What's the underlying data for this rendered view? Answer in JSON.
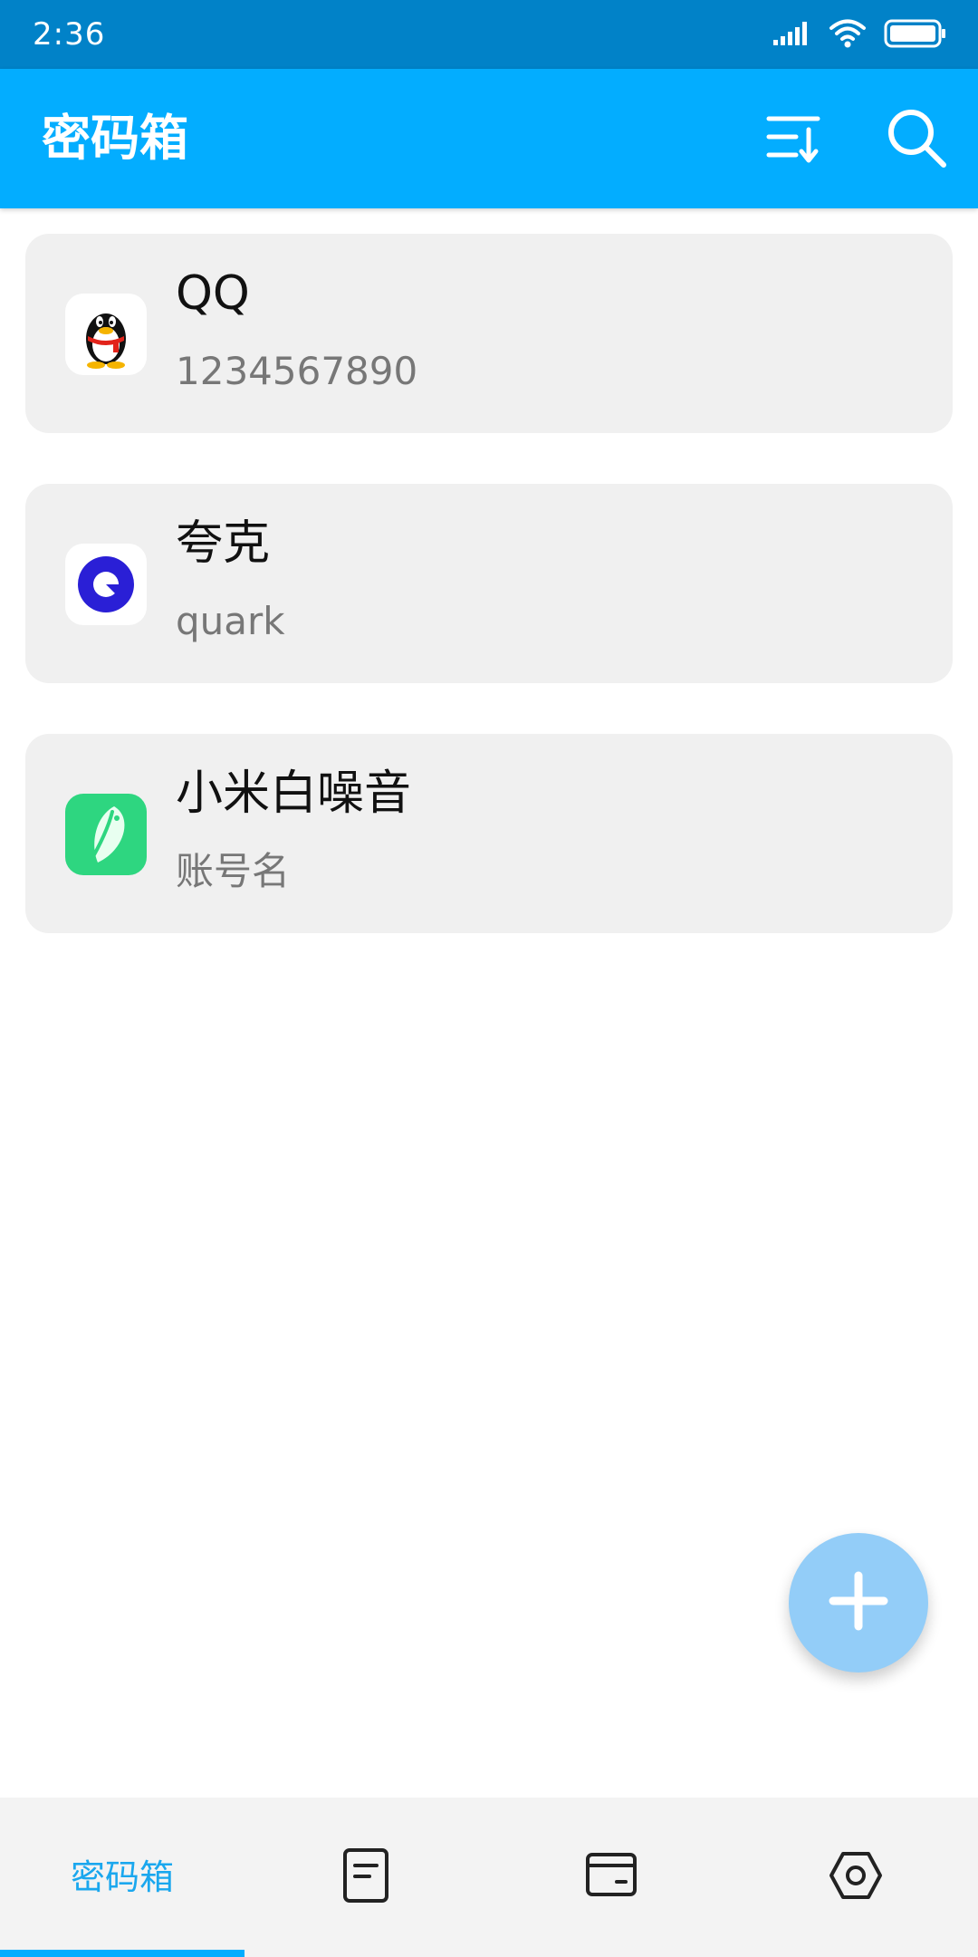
{
  "status_bar": {
    "time": "2:36",
    "icons": [
      "signal-icon",
      "wifi-icon",
      "battery-icon"
    ]
  },
  "app_bar": {
    "title": "密码箱",
    "actions": [
      "sort-icon",
      "search-icon"
    ]
  },
  "entries": [
    {
      "title": "QQ",
      "subtitle": "1234567890",
      "icon": "qq-penguin-icon"
    },
    {
      "title": "夸克",
      "subtitle": "quark",
      "icon": "quark-icon"
    },
    {
      "title": "小米白噪音",
      "subtitle": "账号名",
      "icon": "white-noise-leaf-icon"
    }
  ],
  "fab": {
    "icon": "plus-icon"
  },
  "bottom_nav": {
    "items": [
      {
        "label": "密码箱",
        "active": true
      },
      {
        "icon": "note-icon"
      },
      {
        "icon": "wallet-icon"
      },
      {
        "icon": "settings-hexagon-icon"
      }
    ]
  },
  "colors": {
    "status_bar": "#0182c8",
    "app_bar": "#03adff",
    "card_background": "#f0f0f0",
    "fab": "#93cdf8",
    "active_nav": "#1aa7ee",
    "bottom_nav_background": "#f3f3f3"
  }
}
